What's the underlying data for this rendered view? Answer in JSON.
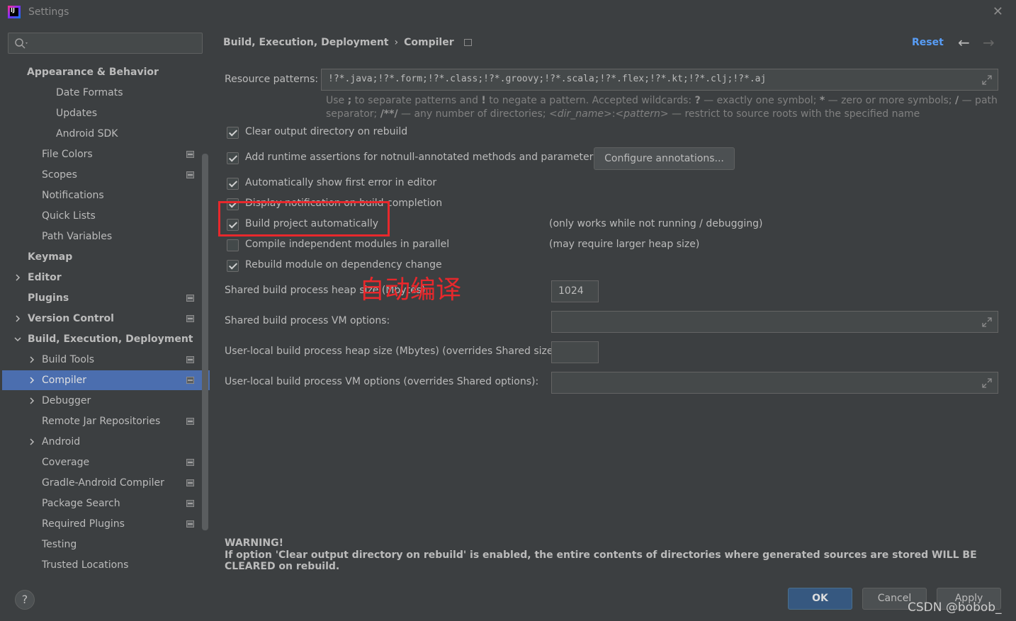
{
  "window": {
    "title": "Settings",
    "close_label": "✕",
    "app_icon_text": "IJ"
  },
  "search": {
    "placeholder": ""
  },
  "sidebar": {
    "items": [
      {
        "label": "Appearance & Behavior"
      },
      {
        "label": "Date Formats"
      },
      {
        "label": "Updates"
      },
      {
        "label": "Android SDK"
      },
      {
        "label": "File Colors"
      },
      {
        "label": "Scopes"
      },
      {
        "label": "Notifications"
      },
      {
        "label": "Quick Lists"
      },
      {
        "label": "Path Variables"
      },
      {
        "label": "Keymap"
      },
      {
        "label": "Editor"
      },
      {
        "label": "Plugins"
      },
      {
        "label": "Version Control"
      },
      {
        "label": "Build, Execution, Deployment"
      },
      {
        "label": "Build Tools"
      },
      {
        "label": "Compiler"
      },
      {
        "label": "Debugger"
      },
      {
        "label": "Remote Jar Repositories"
      },
      {
        "label": "Android"
      },
      {
        "label": "Coverage"
      },
      {
        "label": "Gradle-Android Compiler"
      },
      {
        "label": "Package Search"
      },
      {
        "label": "Required Plugins"
      },
      {
        "label": "Testing"
      },
      {
        "label": "Trusted Locations"
      }
    ]
  },
  "header": {
    "breadcrumb_parent": "Build, Execution, Deployment",
    "breadcrumb_sep": "›",
    "breadcrumb_current": "Compiler",
    "reset_label": "Reset",
    "back_arrow": "←",
    "forward_arrow": "→"
  },
  "compiler": {
    "resource_patterns_label": "Resource patterns:",
    "resource_patterns_value": "!?*.java;!?*.form;!?*.class;!?*.groovy;!?*.scala;!?*.flex;!?*.kt;!?*.clj;!?*.aj",
    "hint_line1_a": "Use ",
    "hint_line1_b": ";",
    "hint_line1_c": " to separate patterns and ",
    "hint_line1_d": "!",
    "hint_line1_e": " to negate a pattern. Accepted wildcards: ",
    "hint_line1_f": "?",
    "hint_line1_g": " — exactly one symbol; ",
    "hint_line1_h": "*",
    "hint_line1_i": " — zero or more symbols; ",
    "hint_line1_j": "/",
    "hint_line1_k": " — path",
    "hint_line2_a": "separator; ",
    "hint_line2_b": "/**/",
    "hint_line2_c": " — any number of directories; ",
    "hint_line2_d": "<dir_name>",
    "hint_line2_e": ":",
    "hint_line2_f": "<pattern>",
    "hint_line2_g": " — restrict to source roots with the specified name",
    "checkboxes": [
      {
        "label": "Clear output directory on rebuild",
        "checked": true
      },
      {
        "label": "Add runtime assertions for notnull-annotated methods and parameters",
        "checked": true
      },
      {
        "label": "Automatically show first error in editor",
        "checked": true
      },
      {
        "label": "Display notification on build completion",
        "checked": true
      },
      {
        "label": "Build project automatically",
        "checked": true
      },
      {
        "label": "Compile independent modules in parallel",
        "checked": false
      },
      {
        "label": "Rebuild module on dependency change",
        "checked": true
      }
    ],
    "configure_annotations_label": "Configure annotations...",
    "note_build_auto": "(only works while not running / debugging)",
    "note_parallel": "(may require larger heap size)",
    "shared_heap_label": "Shared build process heap size (Mbytes):",
    "shared_heap_value": "1024",
    "shared_vm_label": "Shared build process VM options:",
    "shared_vm_value": "",
    "user_heap_label": "User-local build process heap size (Mbytes) (overrides Shared size):",
    "user_heap_value": "",
    "user_vm_label": "User-local build process VM options (overrides Shared options):",
    "user_vm_value": "",
    "warning_title": "WARNING!",
    "warning_text": "If option 'Clear output directory on rebuild' is enabled, the entire contents of directories where generated sources are stored WILL BE CLEARED on rebuild."
  },
  "annotation": {
    "text": "自动编译",
    "color": "#e8282c"
  },
  "footer": {
    "help_label": "?",
    "ok_label": "OK",
    "cancel_label": "Cancel",
    "apply_label": "Apply",
    "watermark": "CSDN @bobob_"
  },
  "colors": {
    "accent": "#4b6eaf",
    "link": "#589df6",
    "background": "#3c3f41"
  }
}
